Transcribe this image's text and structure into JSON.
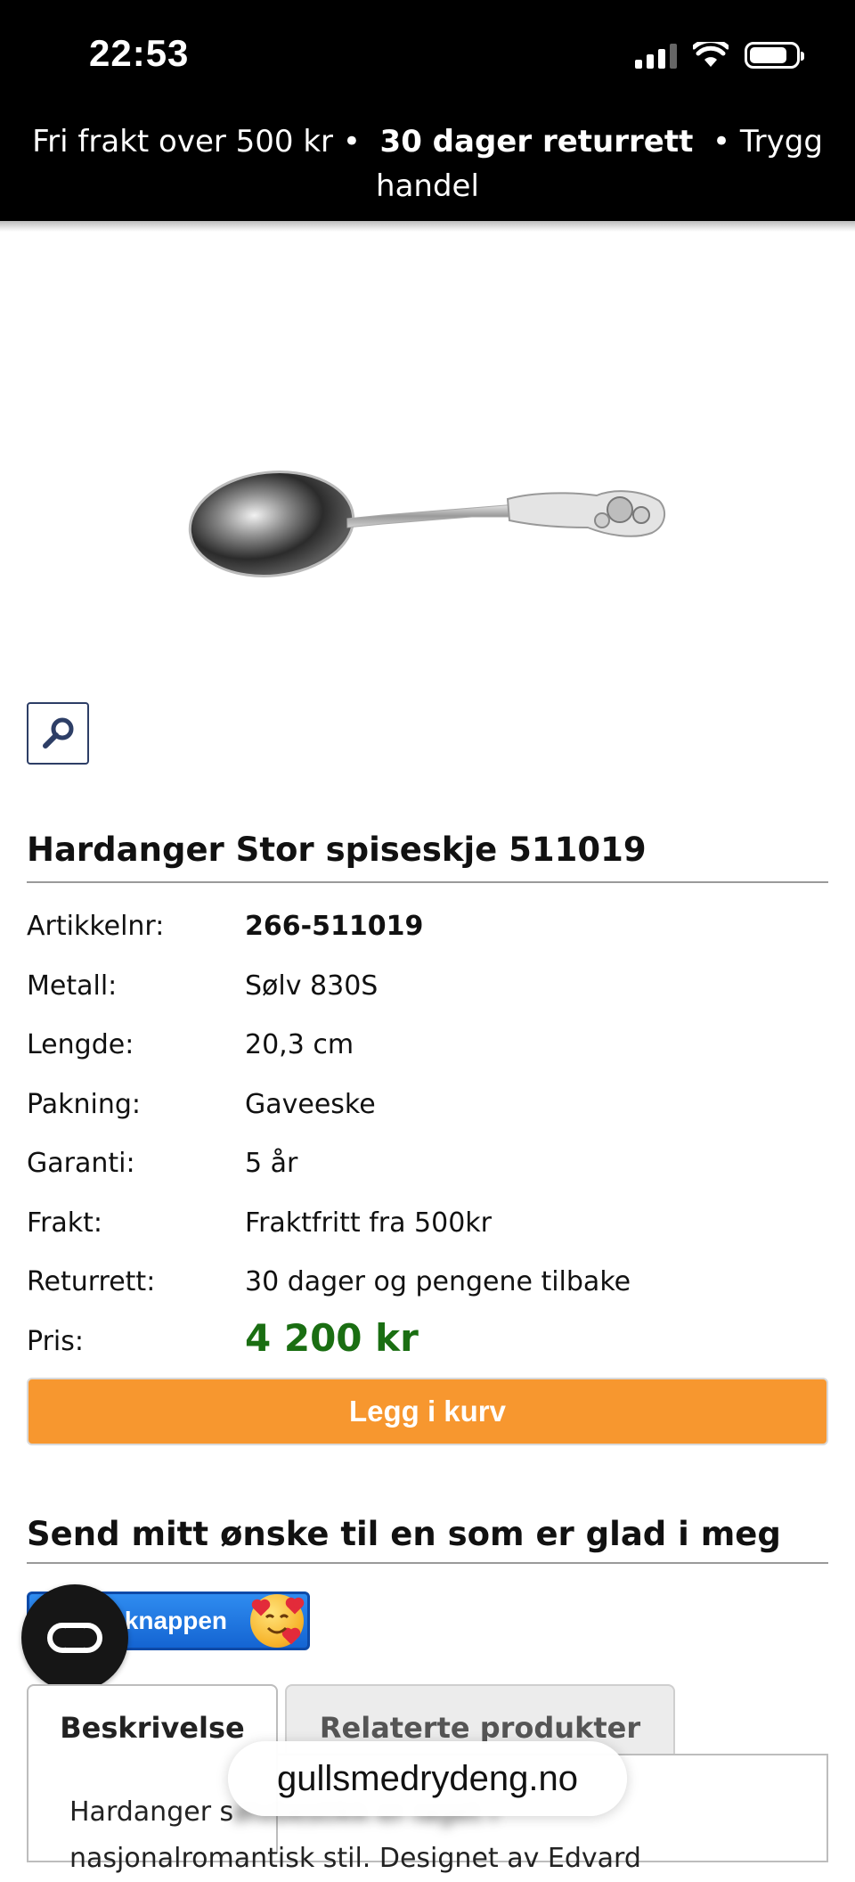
{
  "status_bar": {
    "time": "22:53"
  },
  "promo": {
    "item1": "Fri frakt over 500 kr",
    "separator": "•",
    "item2": "30 dager returrett",
    "item3": "Trygg handel"
  },
  "product": {
    "title": "Hardanger Stor spiseskje 511019",
    "specs": [
      {
        "label": "Artikkelnr:",
        "value": "266-511019"
      },
      {
        "label": "Metall:",
        "value": "Sølv 830S"
      },
      {
        "label": "Lengde:",
        "value": "20,3 cm"
      },
      {
        "label": "Pakning:",
        "value": "Gaveeske"
      },
      {
        "label": "Garanti:",
        "value": "5 år"
      },
      {
        "label": "Frakt:",
        "value": "Fraktfritt fra 500kr"
      },
      {
        "label": "Returrett:",
        "value": "30 dager og pengene tilbake"
      },
      {
        "label": "Pris:",
        "value": "4 200 kr"
      }
    ],
    "add_to_cart": "Legg i kurv",
    "price_color": "#1a6e12"
  },
  "wish": {
    "heading": "Send mitt ønske til en som er glad i meg",
    "button_text": "knappen"
  },
  "tabs": [
    {
      "label": "Beskrivelse"
    },
    {
      "label": "Relaterte produkter"
    }
  ],
  "description": {
    "line1_start": "Hardanger s",
    "line1_blurred": "ølvbestikk er laget i",
    "line2": "nasjonalromantisk stil. Designet av Edvard"
  },
  "browser": {
    "url": "gullsmedrydeng.no"
  },
  "colors": {
    "accent_orange": "#f7972f",
    "wish_blue": "#1f78e6",
    "zoom_border": "#2d3e66"
  }
}
